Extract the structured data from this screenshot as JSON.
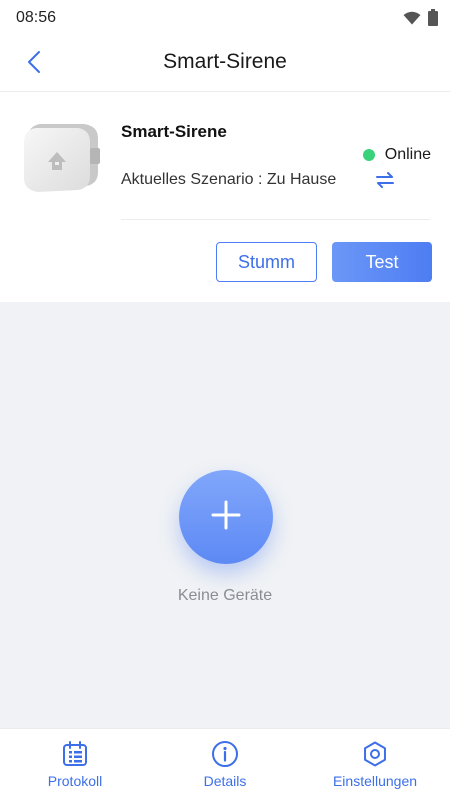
{
  "status_bar": {
    "time": "08:56",
    "wifi_icon": "wifi-icon",
    "battery_icon": "battery-icon"
  },
  "header": {
    "title": "Smart-Sirene",
    "back_icon": "chevron-left-icon"
  },
  "device": {
    "name": "Smart-Sirene",
    "status": "Online",
    "status_color": "#39d27a",
    "scenario": "Aktuelles Szenario : Zu Hause",
    "swap_icon": "swap-arrows-icon"
  },
  "actions": {
    "mute_label": "Stumm",
    "test_label": "Test"
  },
  "empty_state": {
    "text": "Keine Geräte",
    "add_icon": "plus-icon"
  },
  "bottom_nav": {
    "items": [
      {
        "label": "Protokoll",
        "icon": "calendar-list-icon"
      },
      {
        "label": "Details",
        "icon": "info-icon"
      },
      {
        "label": "Einstellungen",
        "icon": "gear-icon"
      }
    ]
  },
  "colors": {
    "accent": "#3d6fe8",
    "background": "#f0f2f5",
    "online": "#39d27a"
  }
}
